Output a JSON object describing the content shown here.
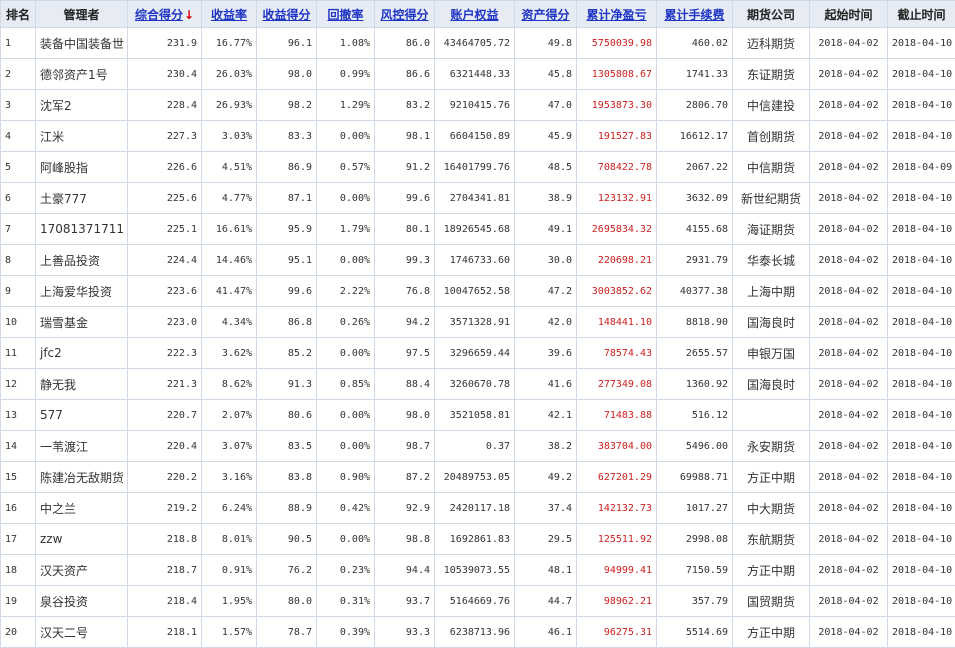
{
  "headers": [
    {
      "label": "排名",
      "sortable": false
    },
    {
      "label": "管理者",
      "sortable": false
    },
    {
      "label": "综合得分",
      "sortable": true,
      "sort_arrow": "↓"
    },
    {
      "label": "收益率",
      "sortable": true
    },
    {
      "label": "收益得分",
      "sortable": true
    },
    {
      "label": "回撤率",
      "sortable": true
    },
    {
      "label": "风控得分",
      "sortable": true
    },
    {
      "label": "账户权益",
      "sortable": true
    },
    {
      "label": "资产得分",
      "sortable": true
    },
    {
      "label": "累计净盈亏",
      "sortable": true
    },
    {
      "label": "累计手续费",
      "sortable": true
    },
    {
      "label": "期货公司",
      "sortable": false
    },
    {
      "label": "起始时间",
      "sortable": false
    },
    {
      "label": "截止时间",
      "sortable": false
    }
  ],
  "colors": {
    "header_bg": "#e6ebf4",
    "sort_link": "#1f35c4",
    "profit_red": "#cc1f1f",
    "grid": "#d2d9e6"
  },
  "rows": [
    [
      "1",
      "装备中国装备世",
      "231.9",
      "16.77%",
      "96.1",
      "1.08%",
      "86.0",
      "43464705.72",
      "49.8",
      "5750039.98",
      "460.02",
      "迈科期货",
      "2018-04-02",
      "2018-04-10"
    ],
    [
      "2",
      "德邻资产1号",
      "230.4",
      "26.03%",
      "98.0",
      "0.99%",
      "86.6",
      "6321448.33",
      "45.8",
      "1305808.67",
      "1741.33",
      "东证期货",
      "2018-04-02",
      "2018-04-10"
    ],
    [
      "3",
      "沈军2",
      "228.4",
      "26.93%",
      "98.2",
      "1.29%",
      "83.2",
      "9210415.76",
      "47.0",
      "1953873.30",
      "2806.70",
      "中信建投",
      "2018-04-02",
      "2018-04-10"
    ],
    [
      "4",
      "江米",
      "227.3",
      "3.03%",
      "83.3",
      "0.00%",
      "98.1",
      "6604150.89",
      "45.9",
      "191527.83",
      "16612.17",
      "首创期货",
      "2018-04-02",
      "2018-04-10"
    ],
    [
      "5",
      "阿峰股指",
      "226.6",
      "4.51%",
      "86.9",
      "0.57%",
      "91.2",
      "16401799.76",
      "48.5",
      "708422.78",
      "2067.22",
      "中信期货",
      "2018-04-02",
      "2018-04-09"
    ],
    [
      "6",
      "土豪777",
      "225.6",
      "4.77%",
      "87.1",
      "0.00%",
      "99.6",
      "2704341.81",
      "38.9",
      "123132.91",
      "3632.09",
      "新世纪期货",
      "2018-04-02",
      "2018-04-10"
    ],
    [
      "7",
      "17081371711",
      "225.1",
      "16.61%",
      "95.9",
      "1.79%",
      "80.1",
      "18926545.68",
      "49.1",
      "2695834.32",
      "4155.68",
      "海证期货",
      "2018-04-02",
      "2018-04-10"
    ],
    [
      "8",
      "上善品投资",
      "224.4",
      "14.46%",
      "95.1",
      "0.00%",
      "99.3",
      "1746733.60",
      "30.0",
      "220698.21",
      "2931.79",
      "华泰长城",
      "2018-04-02",
      "2018-04-10"
    ],
    [
      "9",
      "上海爱华投资",
      "223.6",
      "41.47%",
      "99.6",
      "2.22%",
      "76.8",
      "10047652.58",
      "47.2",
      "3003852.62",
      "40377.38",
      "上海中期",
      "2018-04-02",
      "2018-04-10"
    ],
    [
      "10",
      "瑞雪基金",
      "223.0",
      "4.34%",
      "86.8",
      "0.26%",
      "94.2",
      "3571328.91",
      "42.0",
      "148441.10",
      "8818.90",
      "国海良时",
      "2018-04-02",
      "2018-04-10"
    ],
    [
      "11",
      "jfc2",
      "222.3",
      "3.62%",
      "85.2",
      "0.00%",
      "97.5",
      "3296659.44",
      "39.6",
      "78574.43",
      "2655.57",
      "申银万国",
      "2018-04-02",
      "2018-04-10"
    ],
    [
      "12",
      "静无我",
      "221.3",
      "8.62%",
      "91.3",
      "0.85%",
      "88.4",
      "3260670.78",
      "41.6",
      "277349.08",
      "1360.92",
      "国海良时",
      "2018-04-02",
      "2018-04-10"
    ],
    [
      "13",
      "577",
      "220.7",
      "2.07%",
      "80.6",
      "0.00%",
      "98.0",
      "3521058.81",
      "42.1",
      "71483.88",
      "516.12",
      "",
      "2018-04-02",
      "2018-04-10"
    ],
    [
      "14",
      "一苇渡江",
      "220.4",
      "3.07%",
      "83.5",
      "0.00%",
      "98.7",
      "0.37",
      "38.2",
      "383704.00",
      "5496.00",
      "永安期货",
      "2018-04-02",
      "2018-04-10"
    ],
    [
      "15",
      "陈建冶无敌期货",
      "220.2",
      "3.16%",
      "83.8",
      "0.90%",
      "87.2",
      "20489753.05",
      "49.2",
      "627201.29",
      "69988.71",
      "方正中期",
      "2018-04-02",
      "2018-04-10"
    ],
    [
      "16",
      "中之兰",
      "219.2",
      "6.24%",
      "88.9",
      "0.42%",
      "92.9",
      "2420117.18",
      "37.4",
      "142132.73",
      "1017.27",
      "中大期货",
      "2018-04-02",
      "2018-04-10"
    ],
    [
      "17",
      "zzw",
      "218.8",
      "8.01%",
      "90.5",
      "0.00%",
      "98.8",
      "1692861.83",
      "29.5",
      "125511.92",
      "2998.08",
      "东航期货",
      "2018-04-02",
      "2018-04-10"
    ],
    [
      "18",
      "汉天资产",
      "218.7",
      "0.91%",
      "76.2",
      "0.23%",
      "94.4",
      "10539073.55",
      "48.1",
      "94999.41",
      "7150.59",
      "方正中期",
      "2018-04-02",
      "2018-04-10"
    ],
    [
      "19",
      "泉谷投资",
      "218.4",
      "1.95%",
      "80.0",
      "0.31%",
      "93.7",
      "5164669.76",
      "44.7",
      "98962.21",
      "357.79",
      "国贸期货",
      "2018-04-02",
      "2018-04-10"
    ],
    [
      "20",
      "汉天二号",
      "218.1",
      "1.57%",
      "78.7",
      "0.39%",
      "93.3",
      "6238713.96",
      "46.1",
      "96275.31",
      "5514.69",
      "方正中期",
      "2018-04-02",
      "2018-04-10"
    ]
  ]
}
